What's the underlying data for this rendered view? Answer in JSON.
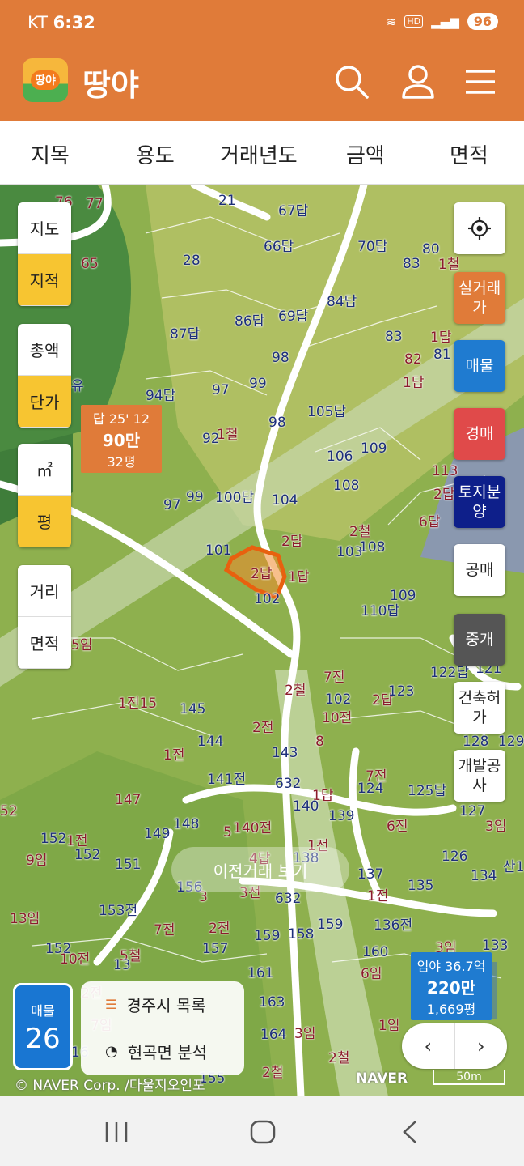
{
  "status_bar": {
    "carrier": "KT",
    "time": "6:32",
    "battery": "96"
  },
  "app": {
    "logo_badge": "땅야",
    "title": "땅야"
  },
  "filters": [
    "지목",
    "용도",
    "거래년도",
    "금액",
    "면적"
  ],
  "left_controls": {
    "map_type": [
      "지도",
      "지적"
    ],
    "price_type": [
      "총액",
      "단가"
    ],
    "unit": [
      "㎡",
      "평"
    ],
    "measure": [
      "거리",
      "면적"
    ]
  },
  "right_controls": {
    "real_price": "실거래가",
    "listings": "매물",
    "auction": "경매",
    "land_sale": "토지분양",
    "public_sale": "공매",
    "brokerage": "중개",
    "building_permit": "건축허가",
    "development": "개발공사"
  },
  "info_box_left": {
    "line1": "답 25' 12",
    "price": "90만",
    "area": "32평"
  },
  "info_box_right": {
    "line1": "임야 36.7억",
    "price": "220만",
    "area": "1,669평"
  },
  "prev_trade_button": "이전거래 보기",
  "listing_count": {
    "label": "매물",
    "count": "26"
  },
  "list_panel": {
    "city_list": "경주시 목록",
    "area_analysis": "현곡면 분석"
  },
  "pager": {
    "prev": "‹",
    "next": "›"
  },
  "copyright": "© NAVER Corp. /다울지오인포",
  "naver_logo": "NAVER",
  "scale": "50m",
  "parcel_labels": [
    "76",
    "77",
    "21",
    "67답",
    "65",
    "28",
    "66답",
    "70답",
    "80",
    "83",
    "1철",
    "87답",
    "86답",
    "69답",
    "84답",
    "83",
    "1답",
    "82",
    "81",
    "1답",
    "94답",
    "97",
    "99",
    "98",
    "105답",
    "유",
    "92",
    "1철",
    "98",
    "106",
    "109",
    "113",
    "2답",
    "97",
    "99",
    "100답",
    "104",
    "108",
    "2답",
    "2철",
    "6답",
    "101",
    "2답",
    "1답",
    "103",
    "108",
    "102",
    "110답",
    "109",
    "5임",
    "2철",
    "7전",
    "122답",
    "121",
    "1전15",
    "145",
    "2전",
    "102",
    "10전",
    "2답",
    "123",
    "144",
    "1전",
    "143",
    "8",
    "128",
    "129",
    "141전",
    "632",
    "7전",
    "1답",
    "124",
    "125답",
    "147",
    "140",
    "139",
    "127",
    "52",
    "152",
    "1전",
    "148",
    "149",
    "5",
    "140전",
    "6전",
    "3임",
    "152",
    "9임",
    "151",
    "4답",
    "138",
    "1전",
    "126",
    "산1",
    "153전",
    "156",
    "3",
    "3전",
    "632",
    "137",
    "1전",
    "135",
    "134",
    "13임",
    "7전",
    "2전",
    "157",
    "159",
    "158",
    "159",
    "136전",
    "3임",
    "133",
    "152",
    "10전",
    "5철",
    "13",
    "161",
    "160",
    "6임",
    "2전",
    "7임",
    "163",
    "1임",
    "164",
    "3임",
    "16",
    "2철",
    "2철",
    "155"
  ]
}
